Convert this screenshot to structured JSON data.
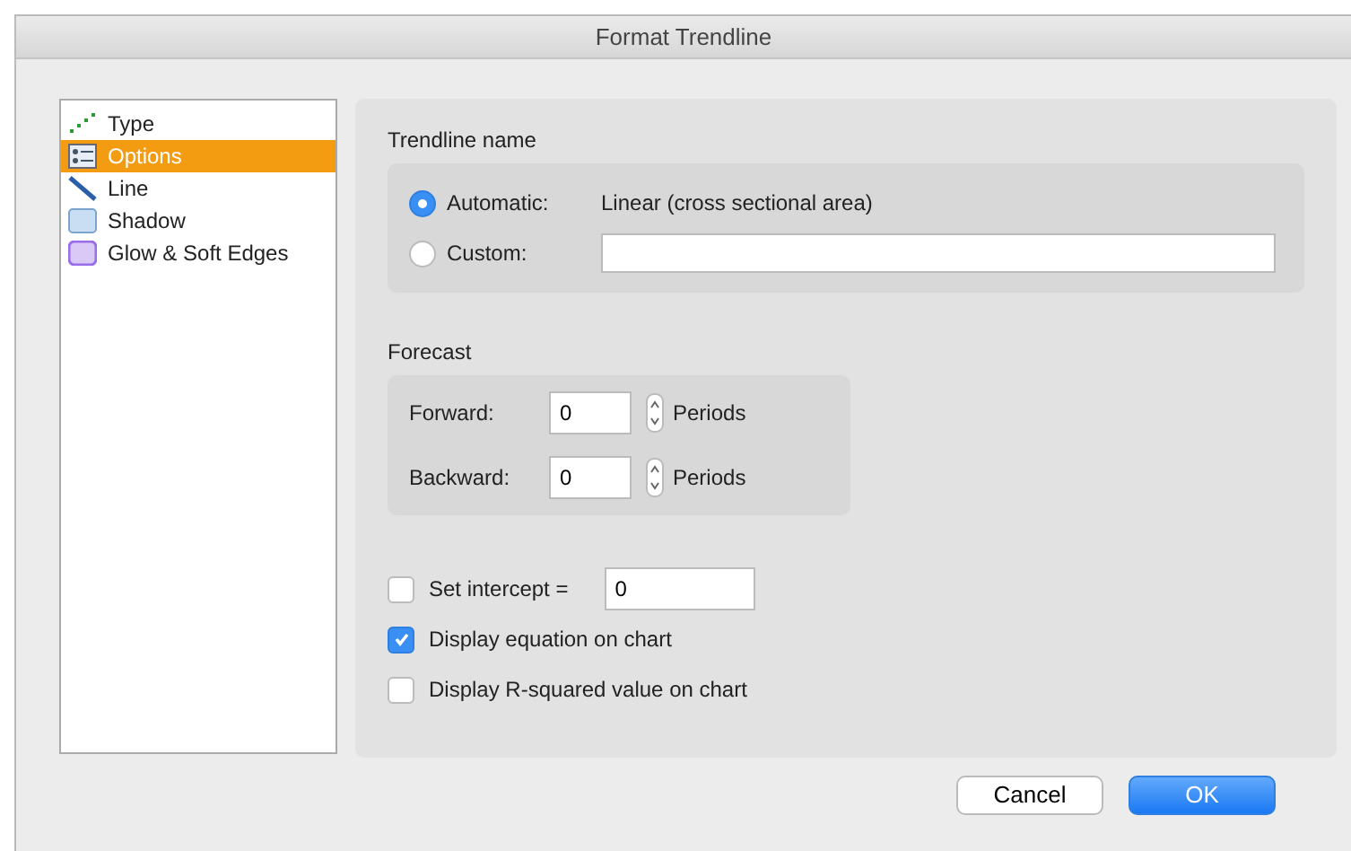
{
  "window": {
    "title": "Format Trendline"
  },
  "sidebar": {
    "items": [
      {
        "label": "Type",
        "selected": false
      },
      {
        "label": "Options",
        "selected": true
      },
      {
        "label": "Line",
        "selected": false
      },
      {
        "label": "Shadow",
        "selected": false
      },
      {
        "label": "Glow & Soft Edges",
        "selected": false
      }
    ]
  },
  "trendline_name": {
    "heading": "Trendline name",
    "options": [
      {
        "label": "Automatic:",
        "selected": true,
        "value": "Linear (cross sectional area)",
        "kind": "text"
      },
      {
        "label": "Custom:",
        "selected": false,
        "kind": "field"
      }
    ]
  },
  "forecast": {
    "heading": "Forecast",
    "rows": [
      {
        "label": "Forward:",
        "value": "0",
        "unit": "Periods"
      },
      {
        "label": "Backward:",
        "value": "0",
        "unit": "Periods"
      }
    ]
  },
  "checks": [
    {
      "label": "Set intercept =",
      "checked": false,
      "value": "0"
    },
    {
      "label": "Display equation on chart",
      "checked": true
    },
    {
      "label": "Display R-squared value on chart",
      "checked": false
    }
  ],
  "buttons": [
    {
      "label": "Cancel",
      "kind": "secondary"
    },
    {
      "label": "OK",
      "kind": "primary"
    }
  ]
}
